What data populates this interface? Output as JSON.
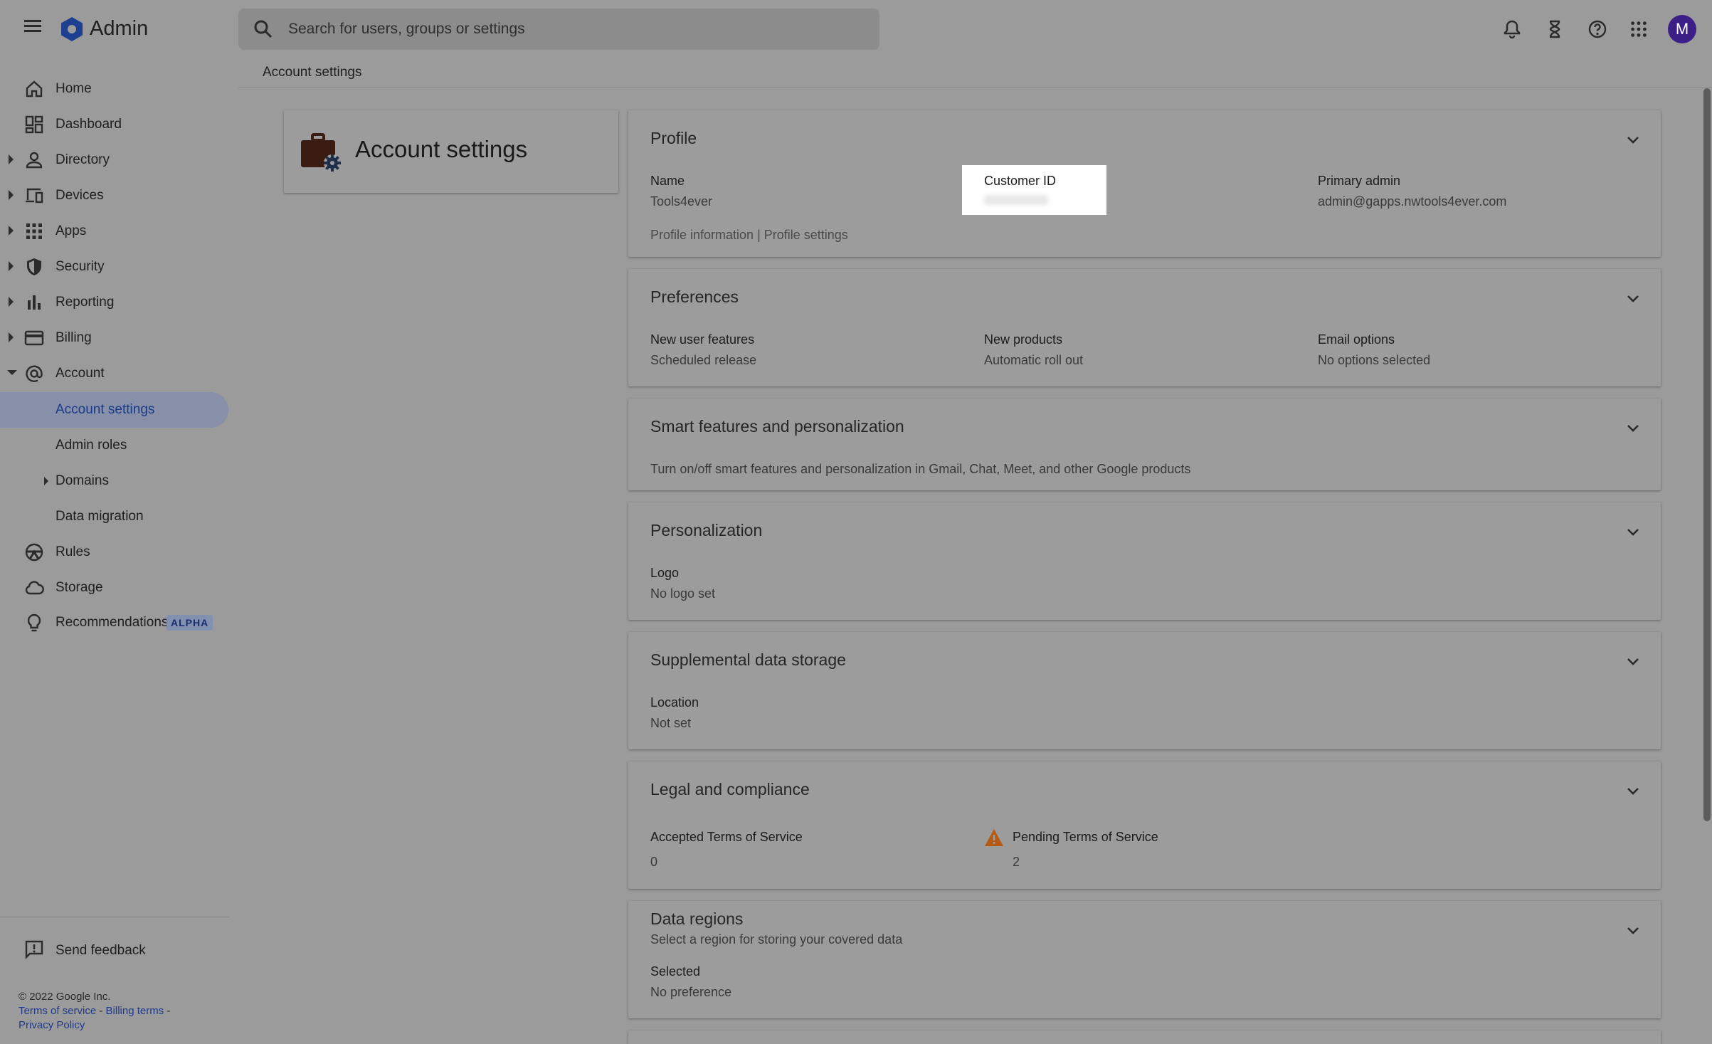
{
  "app": {
    "title": "Admin",
    "avatar_letter": "M"
  },
  "search": {
    "placeholder": "Search for users, groups or settings"
  },
  "breadcrumb": "Account settings",
  "sidebar": {
    "items": [
      {
        "label": "Home",
        "icon": "home-icon"
      },
      {
        "label": "Dashboard",
        "icon": "dashboard-icon"
      },
      {
        "label": "Directory",
        "icon": "person-icon"
      },
      {
        "label": "Devices",
        "icon": "devices-icon"
      },
      {
        "label": "Apps",
        "icon": "apps-grid-icon"
      },
      {
        "label": "Security",
        "icon": "shield-icon"
      },
      {
        "label": "Reporting",
        "icon": "bar-chart-icon"
      },
      {
        "label": "Billing",
        "icon": "credit-card-icon"
      },
      {
        "label": "Account",
        "icon": "at-sign-icon"
      },
      {
        "label": "Account settings"
      },
      {
        "label": "Admin roles"
      },
      {
        "label": "Domains"
      },
      {
        "label": "Data migration"
      },
      {
        "label": "Rules",
        "icon": "steering-icon"
      },
      {
        "label": "Storage",
        "icon": "cloud-icon"
      },
      {
        "label": "Recommendations",
        "icon": "lightbulb-icon",
        "badge": "ALPHA"
      }
    ],
    "feedback": "Send feedback",
    "footer": {
      "copyright": "© 2022 Google Inc.",
      "terms": "Terms of service",
      "billing_terms": "Billing terms",
      "privacy": "Privacy Policy",
      "sep": "-"
    }
  },
  "title_card": {
    "title": "Account settings"
  },
  "cards": {
    "profile": {
      "title": "Profile",
      "name_label": "Name",
      "name_value": "Tools4ever",
      "customer_id_label": "Customer ID",
      "primary_admin_label": "Primary admin",
      "primary_admin_value": "admin@gapps.nwtools4ever.com",
      "links": "Profile information | Profile settings"
    },
    "preferences": {
      "title": "Preferences",
      "f1_label": "New user features",
      "f1_value": "Scheduled release",
      "f2_label": "New products",
      "f2_value": "Automatic roll out",
      "f3_label": "Email options",
      "f3_value": "No options selected"
    },
    "smart": {
      "title": "Smart features and personalization",
      "desc": "Turn on/off smart features and personalization in Gmail, Chat, Meet, and other Google products"
    },
    "personalization": {
      "title": "Personalization",
      "f1_label": "Logo",
      "f1_value": "No logo set"
    },
    "supplemental": {
      "title": "Supplemental data storage",
      "f1_label": "Location",
      "f1_value": "Not set"
    },
    "legal": {
      "title": "Legal and compliance",
      "f1_label": "Accepted Terms of Service",
      "f1_value": "0",
      "f2_label": "Pending Terms of Service",
      "f2_value": "2"
    },
    "regions": {
      "title": "Data regions",
      "subtitle": "Select a region for storing your covered data",
      "f1_label": "Selected",
      "f1_value": "No preference"
    }
  }
}
